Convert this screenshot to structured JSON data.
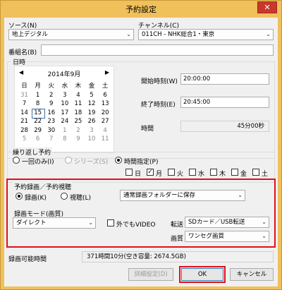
{
  "window": {
    "title": "予約設定",
    "close_label": "✕"
  },
  "source": {
    "label": "ソース(N)",
    "value": "地上デジタル"
  },
  "channel": {
    "label": "チャンネル(C)",
    "value": "011CH - NHK総合1・東京"
  },
  "program": {
    "label": "番組名(B)",
    "value": ""
  },
  "datetime": {
    "group_label": "日時",
    "calendar": {
      "title": "2014年9月",
      "prev": "◀",
      "next": "▶",
      "weekdays": [
        "日",
        "月",
        "火",
        "水",
        "木",
        "金",
        "土"
      ],
      "weeks": [
        [
          "31",
          "1",
          "2",
          "3",
          "4",
          "5",
          "6"
        ],
        [
          "7",
          "8",
          "9",
          "10",
          "11",
          "12",
          "13"
        ],
        [
          "14",
          "15",
          "16",
          "17",
          "18",
          "19",
          "20"
        ],
        [
          "21",
          "22",
          "23",
          "24",
          "25",
          "26",
          "27"
        ],
        [
          "28",
          "29",
          "30",
          "1",
          "2",
          "3",
          "4"
        ],
        [
          "5",
          "6",
          "7",
          "8",
          "9",
          "10",
          "11"
        ]
      ],
      "selected": "15"
    },
    "start_label": "開始時刻(W)",
    "start_value": "20:00:00",
    "end_label": "終了時刻(E)",
    "end_value": "20:45:00",
    "duration_label": "時間",
    "duration_value": "45分00秒"
  },
  "repeat": {
    "group_label": "繰り返し予約",
    "once": "一回のみ(I)",
    "series": "シリーズ(S)",
    "time_specified": "時間指定(P)",
    "selected": "time_specified",
    "days": [
      {
        "label": "日",
        "checked": false
      },
      {
        "label": "月",
        "checked": true
      },
      {
        "label": "火",
        "checked": false
      },
      {
        "label": "水",
        "checked": false
      },
      {
        "label": "木",
        "checked": false
      },
      {
        "label": "金",
        "checked": false
      },
      {
        "label": "土",
        "checked": false
      }
    ],
    "check_mark": "✓"
  },
  "record": {
    "group_label": "予約録画／予約視聴",
    "record_option": "録画(K)",
    "view_option": "視聴(L)",
    "selected": "record",
    "folder": "通常録画フォルダーに保存"
  },
  "mode": {
    "group_label": "録画モード(画質)",
    "mode_value": "ダイレクト",
    "outside_video_label": "外でもVIDEO",
    "transfer_label": "転送",
    "transfer_value": "SDカード／USB転送",
    "quality_label": "画質",
    "quality_value": "ワンセグ画質"
  },
  "available": {
    "label": "録画可能時間",
    "value": "371時間10分(空き容量: 2674.5GB)"
  },
  "buttons": {
    "detail": "詳細設定(D)",
    "ok": "OK",
    "cancel": "キャンセル"
  },
  "colors": {
    "titlebar": "#f0c05a",
    "highlight": "#e0101a",
    "close": "#c7382a"
  }
}
